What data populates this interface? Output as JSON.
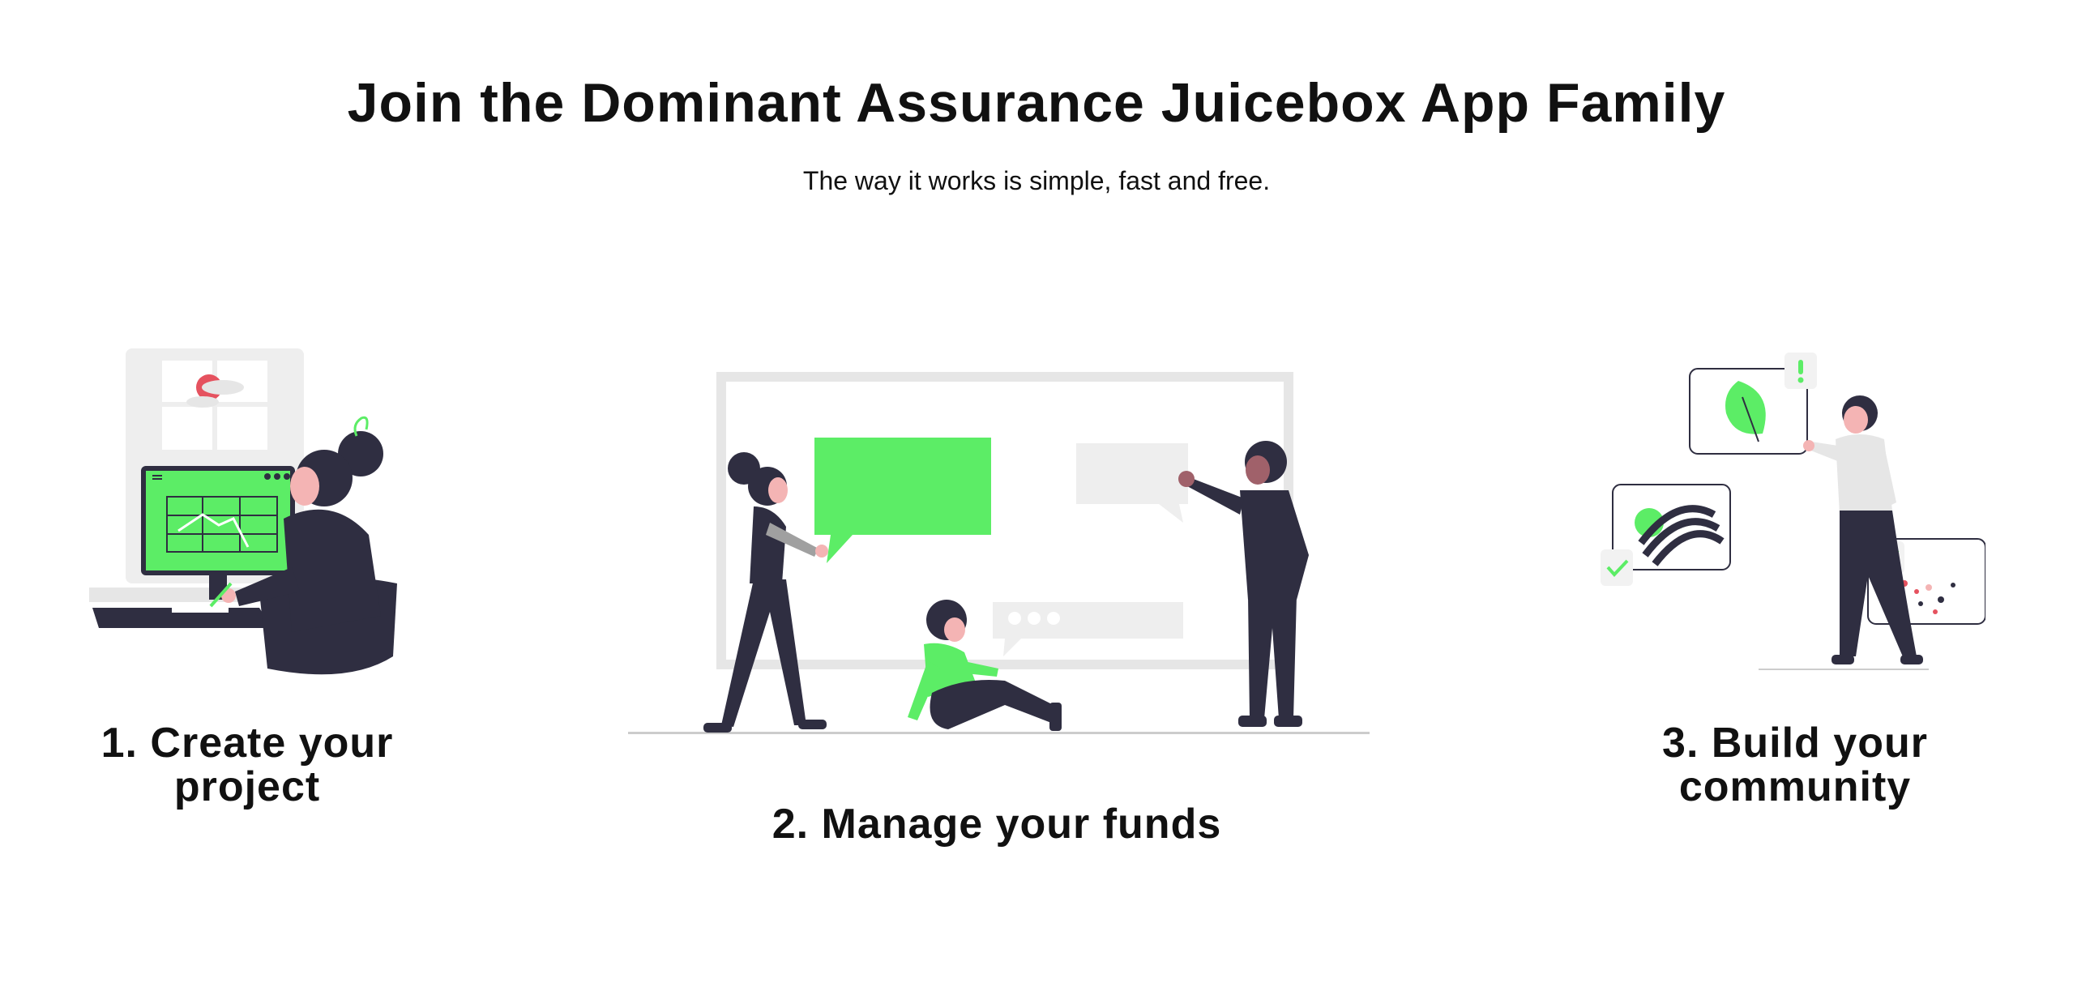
{
  "header": {
    "title": "Join the Dominant Assurance Juicebox App Family",
    "subtitle": "The way it works is simple, fast and free."
  },
  "steps": [
    {
      "title": "1. Create your project",
      "image_icon": "person-at-computer-illustration"
    },
    {
      "title": "2. Manage your funds",
      "image_icon": "team-discussion-whiteboard-illustration"
    },
    {
      "title": "3. Build your community",
      "image_icon": "person-with-floating-cards-illustration"
    }
  ],
  "colors": {
    "accent": "#5ced66",
    "dark": "#2f2e41",
    "light_gray": "#e8e8e8",
    "skin": "#f4b4b4",
    "red": "#e5525f"
  }
}
